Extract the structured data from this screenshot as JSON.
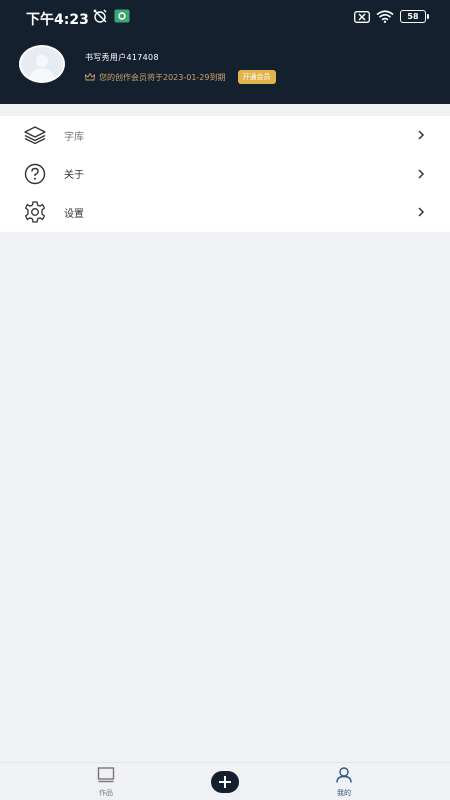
{
  "status_bar": {
    "time": "下午4:23",
    "battery": "58",
    "icons_left": [
      "alarm-off-icon",
      "shield-badge-icon"
    ],
    "icons_right": [
      "sim-x-icon",
      "wifi-icon",
      "battery-icon"
    ]
  },
  "profile": {
    "username": "书写秀用户417408",
    "vip_text": "您的创作会员将于2023-01-29到期",
    "vip_button": "开通会员",
    "crown_icon": "crown-icon"
  },
  "menu": {
    "items": [
      {
        "label": "字库",
        "icon": "layers-icon"
      },
      {
        "label": "关于",
        "icon": "question-circle-icon"
      },
      {
        "label": "设置",
        "icon": "gear-icon"
      }
    ]
  },
  "tabbar": {
    "works": "作品",
    "mine": "我的",
    "add": "plus-icon"
  },
  "colors": {
    "header_bg": "#14202e",
    "accent_gold": "#e2b44c",
    "active_tab": "#2a5785",
    "page_bg": "#f0f1f4"
  }
}
